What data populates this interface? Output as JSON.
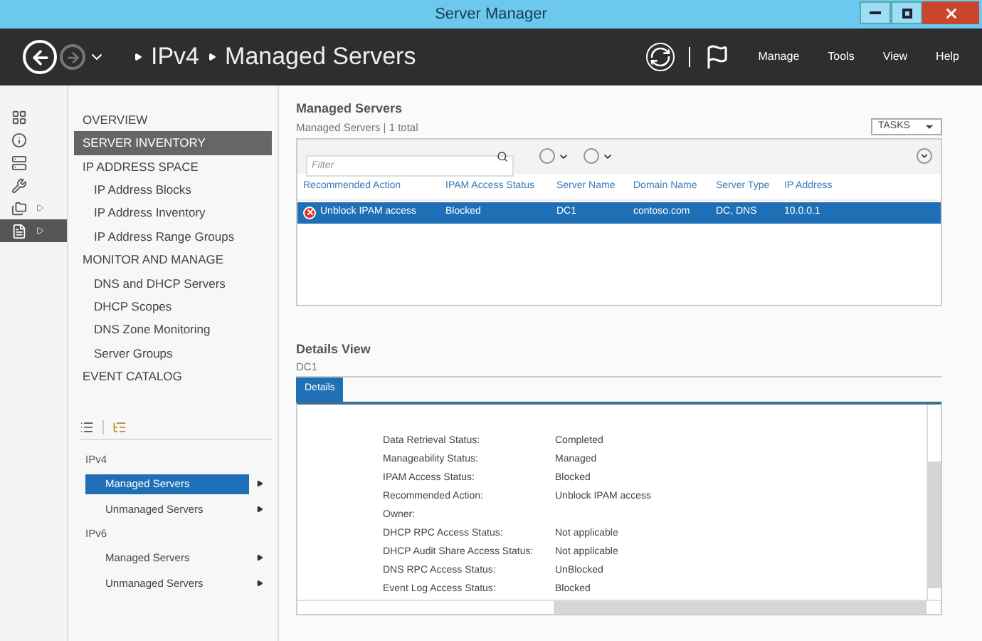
{
  "window": {
    "title": "Server Manager"
  },
  "toolbar": {
    "breadcrumb": [
      "IPv4",
      "Managed Servers"
    ],
    "menu": [
      "Manage",
      "Tools",
      "View",
      "Help"
    ]
  },
  "icon_strip": [
    {
      "kind": "grid",
      "selected": false,
      "expandable": false
    },
    {
      "kind": "info",
      "selected": false,
      "expandable": false
    },
    {
      "kind": "servers",
      "selected": false,
      "expandable": false
    },
    {
      "kind": "tools",
      "selected": false,
      "expandable": false
    },
    {
      "kind": "folders",
      "selected": false,
      "expandable": true
    },
    {
      "kind": "file",
      "selected": true,
      "expandable": true
    }
  ],
  "nav": [
    {
      "label": "OVERVIEW",
      "kind": "heading",
      "selected": false
    },
    {
      "label": "SERVER INVENTORY",
      "kind": "heading",
      "selected": true
    },
    {
      "label": "IP ADDRESS SPACE",
      "kind": "heading",
      "selected": false
    },
    {
      "label": "IP Address Blocks",
      "kind": "item",
      "selected": false
    },
    {
      "label": "IP Address Inventory",
      "kind": "item",
      "selected": false
    },
    {
      "label": "IP Address Range Groups",
      "kind": "item",
      "selected": false
    },
    {
      "label": "MONITOR AND MANAGE",
      "kind": "heading",
      "selected": false
    },
    {
      "label": "DNS and DHCP Servers",
      "kind": "item",
      "selected": false
    },
    {
      "label": "DHCP Scopes",
      "kind": "item",
      "selected": false
    },
    {
      "label": "DNS Zone Monitoring",
      "kind": "item",
      "selected": false
    },
    {
      "label": "Server Groups",
      "kind": "item",
      "selected": false
    },
    {
      "label": "EVENT CATALOG",
      "kind": "heading",
      "selected": false
    }
  ],
  "tree": [
    {
      "label": "IPv4",
      "children": [
        {
          "label": "Managed Servers",
          "selected": true
        },
        {
          "label": "Unmanaged Servers",
          "selected": false
        }
      ]
    },
    {
      "label": "IPv6",
      "children": [
        {
          "label": "Managed Servers",
          "selected": false
        },
        {
          "label": "Unmanaged Servers",
          "selected": false
        }
      ]
    }
  ],
  "servers": {
    "title": "Managed Servers",
    "subtitle": "Managed Servers | 1 total",
    "tasks": "TASKS",
    "filter": {
      "placeholder": "Filter"
    },
    "columns": [
      "Recommended Action",
      "IPAM Access Status",
      "Server Name",
      "Domain Name",
      "Server Type",
      "IP Address"
    ],
    "rows": [
      {
        "selected": true,
        "error": true,
        "cells": [
          "Unblock IPAM access",
          "Blocked",
          "DC1",
          "contoso.com",
          "DC, DNS",
          "10.0.0.1"
        ]
      }
    ]
  },
  "details": {
    "title": "Details View",
    "subtitle": "DC1",
    "tabs": [
      {
        "label": "Details",
        "selected": true
      }
    ],
    "fields": [
      {
        "label": "Data Retrieval Status:",
        "value": "Completed"
      },
      {
        "label": "Manageability Status:",
        "value": "Managed"
      },
      {
        "label": "IPAM Access Status:",
        "value": "Blocked"
      },
      {
        "label": "Recommended Action:",
        "value": "Unblock IPAM access"
      },
      {
        "label": "Owner:"
      },
      {
        "label": "DHCP RPC Access Status:",
        "value": "Not applicable"
      },
      {
        "label": "DHCP Audit Share Access Status:",
        "value": "Not applicable"
      },
      {
        "label": "DNS RPC Access Status:",
        "value": "UnBlocked"
      },
      {
        "label": "Event Log Access Status:",
        "value": "Blocked"
      }
    ]
  }
}
